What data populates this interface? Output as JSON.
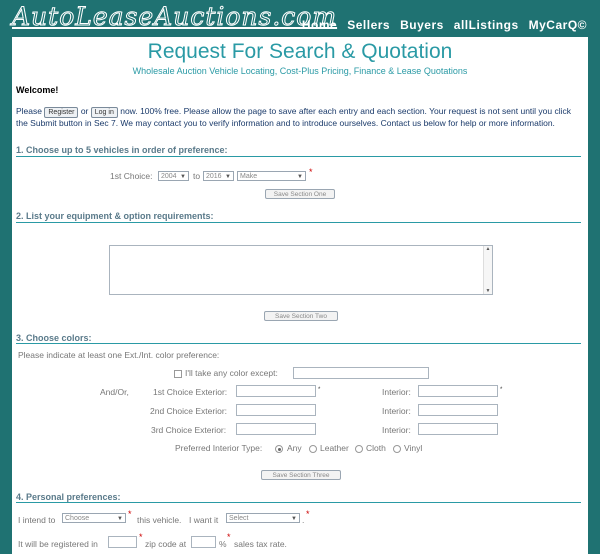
{
  "brand": {
    "logo": "AutoLeaseAuctions.com"
  },
  "nav": [
    {
      "label": "Home"
    },
    {
      "label": "Sellers"
    },
    {
      "label": "Buyers"
    },
    {
      "label": "allListings"
    },
    {
      "label": "MyCarQ©"
    }
  ],
  "page": {
    "title": "Request For Search & Quotation",
    "subtitle": "Wholesale Auction Vehicle Locating, Cost-Plus Pricing, Finance & Lease Quotations",
    "welcome": "Welcome!"
  },
  "intro": {
    "please": "Please",
    "register_label": "Register",
    "or": "or",
    "login_label": "Log in",
    "now_free": "now. 100% free.",
    "text": "Please allow the page to save after each entry and each section. Your request is not sent until you click the Submit button in Sec 7. We may contact you to verify information and to introduce ourselves. Contact us below for help or more information."
  },
  "section1": {
    "title": "1. Choose up to 5 vehicles in order of preference:",
    "first_choice_label": "1st Choice:",
    "year_from": "2004",
    "to_label": "to",
    "year_to": "2016",
    "make": "Make",
    "save_label": "Save Section One"
  },
  "section2": {
    "title": "2. List your equipment & option requirements:",
    "save_label": "Save Section Two"
  },
  "section3": {
    "title": "3. Choose colors:",
    "instruction": "Please indicate at least one Ext./Int. color preference:",
    "any_color_label": "I'll take any color except:",
    "and_or": "And/Or,",
    "ext1": "1st Choice Exterior:",
    "ext2": "2nd Choice Exterior:",
    "ext3": "3rd Choice Exterior:",
    "interior": "Interior:",
    "interior_type_label": "Preferred Interior Type:",
    "interior_types": [
      "Any",
      "Leather",
      "Cloth",
      "Vinyl"
    ],
    "save_label": "Save Section Three"
  },
  "section4": {
    "title": "4. Personal preferences:",
    "intend_label": "I intend to",
    "intend_value": "Choose",
    "vehicle_label": "this vehicle.",
    "want_label": "I want it",
    "want_value": "Select",
    "registered_label": "It will be registered in",
    "zip_label": "zip code at",
    "percent": "%",
    "tax_label": "sales tax rate."
  },
  "symbols": {
    "required": "*",
    "period": "."
  }
}
